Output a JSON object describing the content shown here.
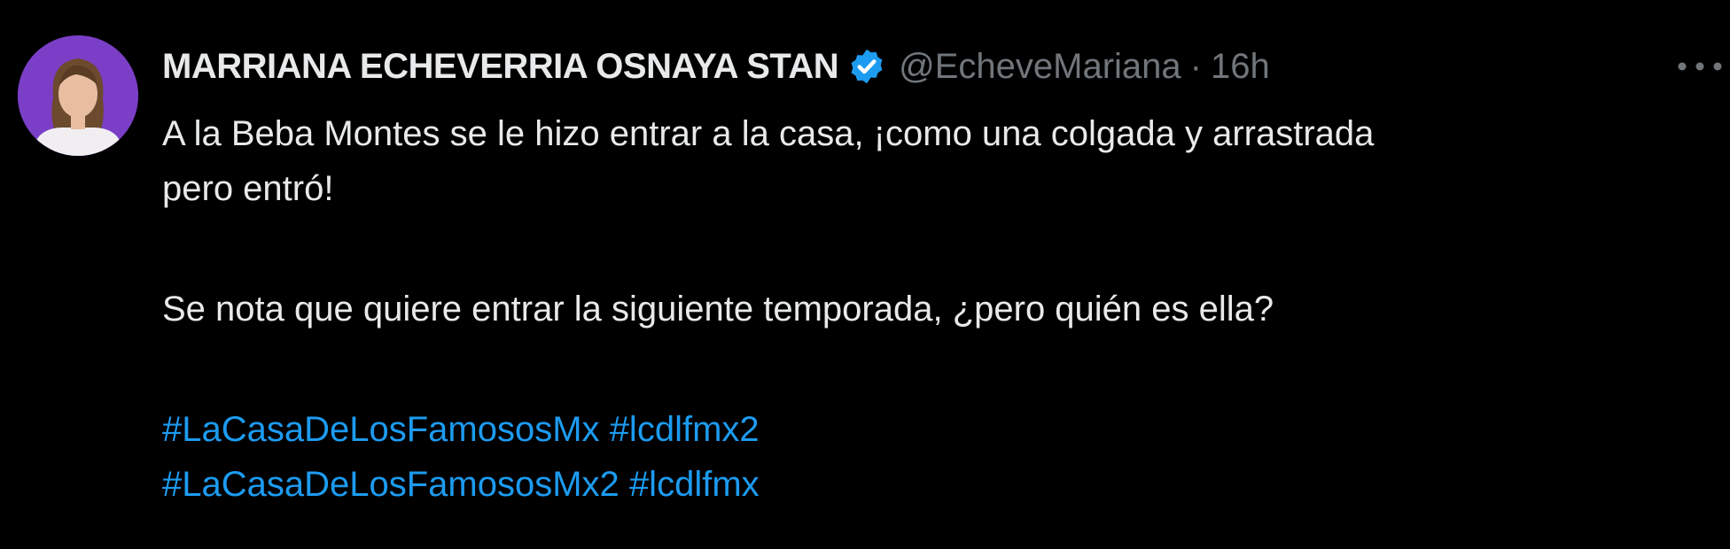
{
  "tweet": {
    "display_name": "MARRIANA ECHEVERRIA OSNAYA STAN",
    "handle": "@EcheveMariana",
    "separator": "·",
    "time": "16h",
    "more_label": "···",
    "lines": [
      "A la Beba Montes se le hizo entrar a la casa, ¡como una colgada y arrastrada",
      "pero entró!",
      "Se nota que quiere entrar la siguiente temporada, ¿pero quién es ella?"
    ],
    "hashtags": [
      "#LaCasaDeLosFamososMx",
      "#lcdlfmx2",
      "#LaCasaDeLosFamososMx2",
      "#lcdlfmx"
    ]
  },
  "colors": {
    "background": "#000000",
    "text": "#e7e9ea",
    "muted": "#71767b",
    "link": "#1d9bf0",
    "verified_badge": "#1d9bf0",
    "avatar_bg": "#7b3fc7"
  },
  "icons": {
    "verified": "verified-badge-icon",
    "more": "more-options-icon"
  }
}
